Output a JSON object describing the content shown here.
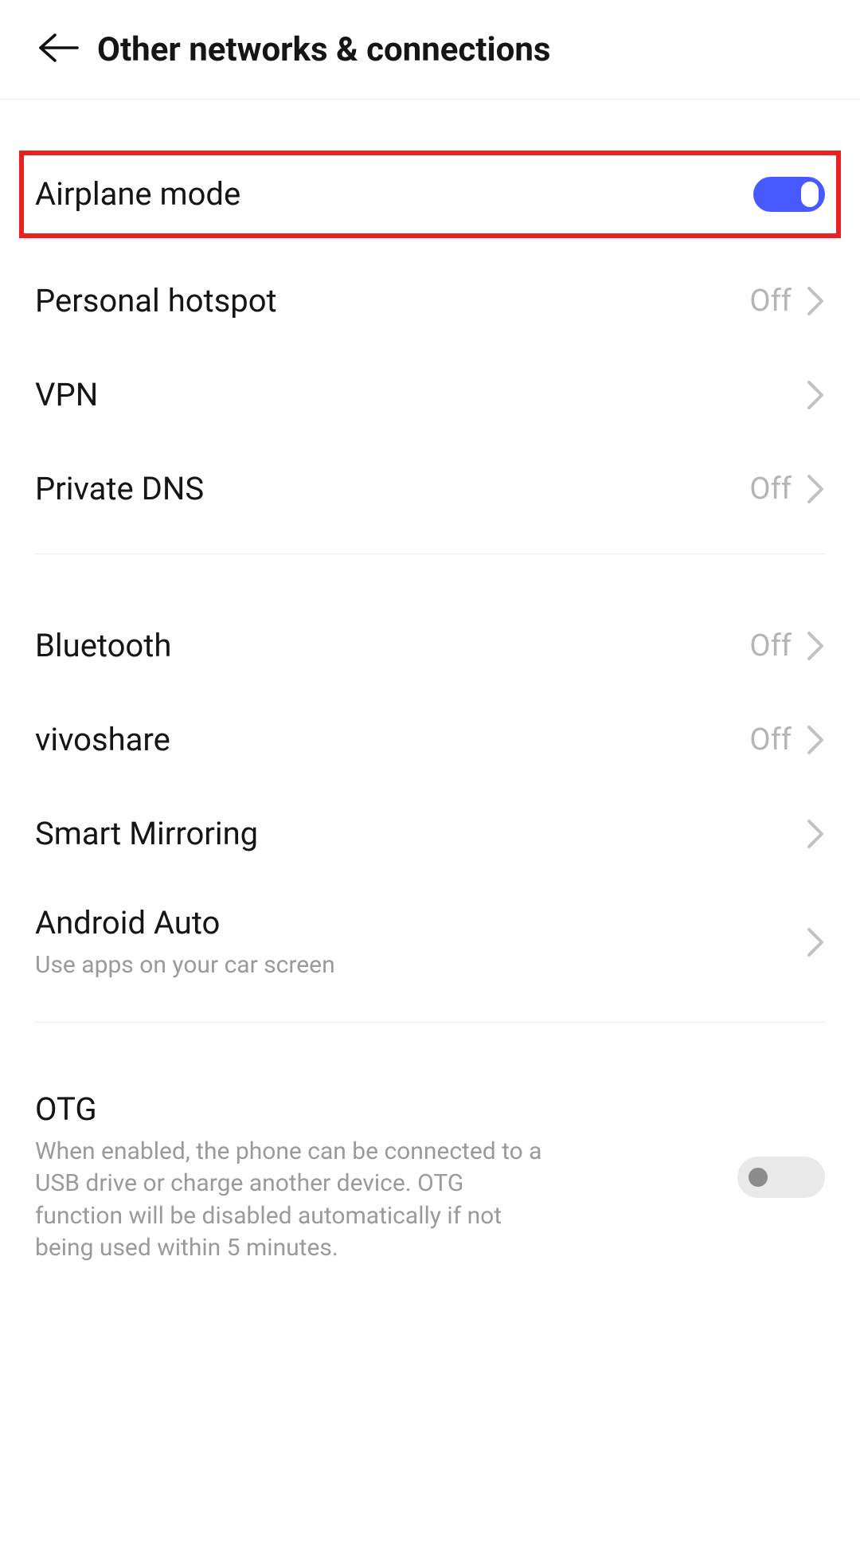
{
  "header": {
    "title": "Other networks & connections"
  },
  "items": {
    "airplane_mode": {
      "label": "Airplane mode",
      "toggle": "on",
      "highlighted": true
    },
    "personal_hotspot": {
      "label": "Personal hotspot",
      "value": "Off"
    },
    "vpn": {
      "label": "VPN"
    },
    "private_dns": {
      "label": "Private DNS",
      "value": "Off"
    },
    "bluetooth": {
      "label": "Bluetooth",
      "value": "Off"
    },
    "vivoshare": {
      "label": "vivoshare",
      "value": "Off"
    },
    "smart_mirroring": {
      "label": "Smart Mirroring"
    },
    "android_auto": {
      "label": "Android Auto",
      "sublabel": "Use apps on your car screen"
    },
    "otg": {
      "label": "OTG",
      "sublabel": "When enabled, the phone can be connected to a USB drive or charge another device. OTG function will be disabled automatically if not being used within 5 minutes.",
      "toggle": "off"
    }
  }
}
